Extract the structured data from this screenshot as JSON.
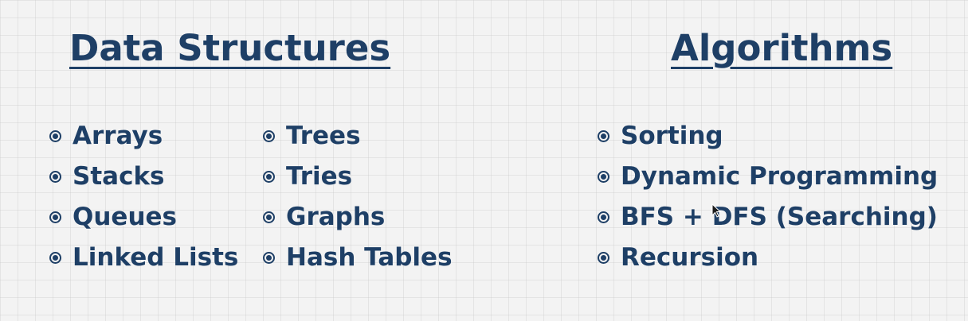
{
  "data_structures": {
    "heading": "Data Structures",
    "column1": [
      "Arrays",
      "Stacks",
      "Queues",
      "Linked Lists"
    ],
    "column2": [
      "Trees",
      "Tries",
      "Graphs",
      "Hash Tables"
    ]
  },
  "algorithms": {
    "heading": "Algorithms",
    "items": [
      "Sorting",
      "Dynamic Programming",
      "BFS + DFS (Searching)",
      "Recursion"
    ]
  },
  "colors": {
    "text": "#1e3f66",
    "background": "#f3f3f3"
  },
  "icons": {
    "bullet": "radio-bullet-icon",
    "cursor": "mouse-pointer-icon"
  }
}
